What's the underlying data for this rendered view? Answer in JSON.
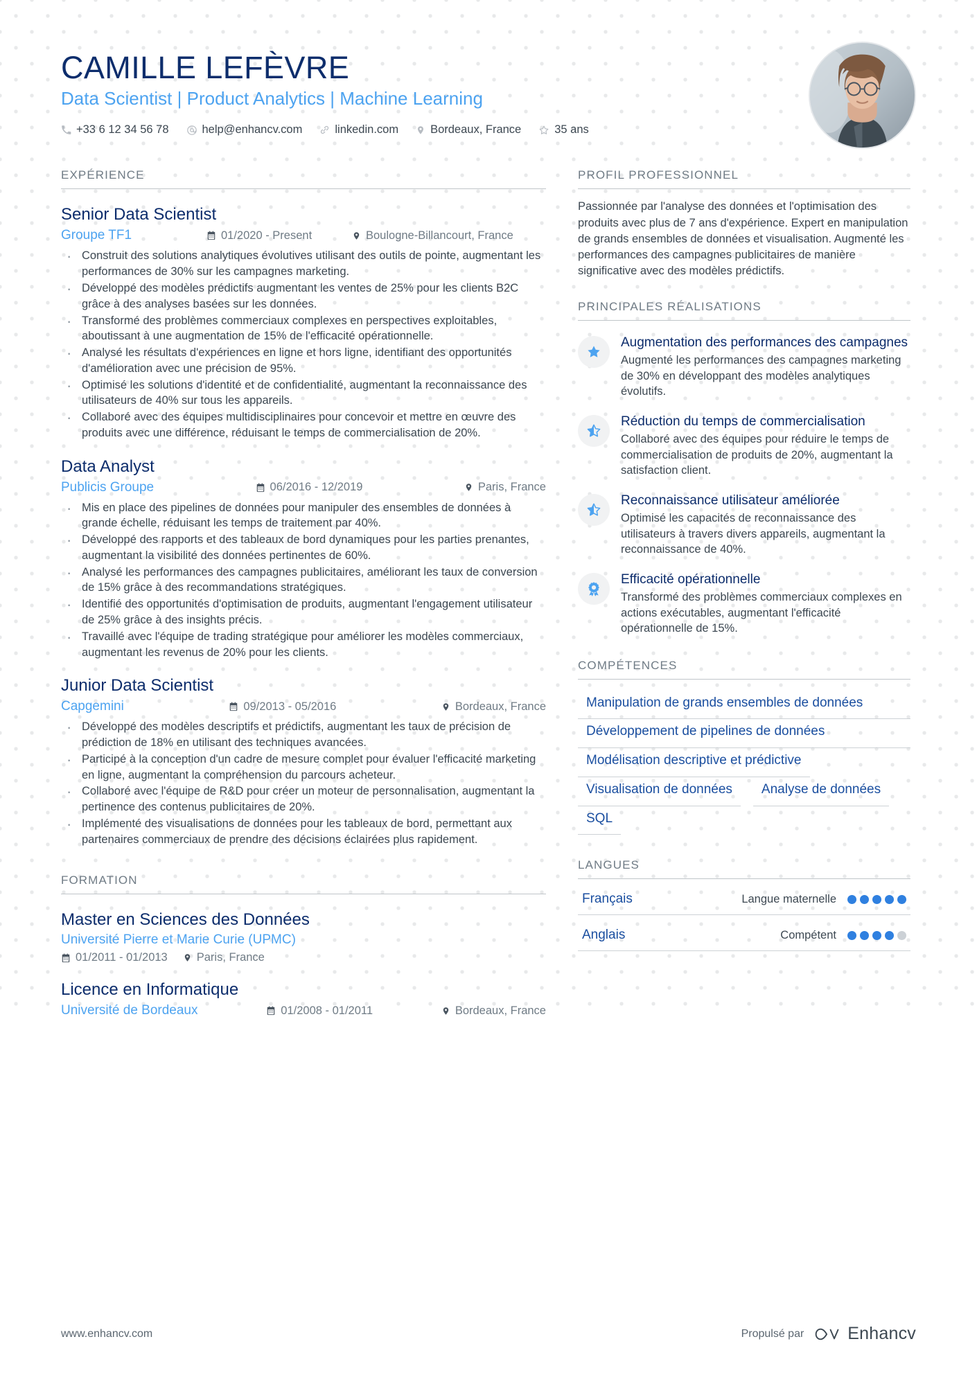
{
  "header": {
    "name": "CAMILLE LEFÈVRE",
    "headline": "Data Scientist | Product Analytics | Machine Learning",
    "contacts": [
      {
        "icon": "phone-icon",
        "text": "+33 6 12 34 56 78"
      },
      {
        "icon": "email-icon",
        "text": "help@enhancv.com"
      },
      {
        "icon": "link-icon",
        "text": "linkedin.com"
      },
      {
        "icon": "location-pin-icon",
        "text": "Bordeaux, France"
      },
      {
        "icon": "star-outline-icon",
        "text": "35 ans"
      }
    ],
    "avatar_alt": "profile-photo"
  },
  "experience": {
    "title": "EXPÉRIENCE",
    "entries": [
      {
        "role": "Senior Data Scientist",
        "company": "Groupe TF1",
        "dates": "01/2020 - Present",
        "location": "Boulogne-Billancourt, France",
        "bullets": [
          "Construit des solutions analytiques évolutives utilisant des outils de pointe, augmentant les performances de 30% sur les campagnes marketing.",
          "Développé des modèles prédictifs augmentant les ventes de 25% pour les clients B2C grâce à des analyses basées sur les données.",
          "Transformé des problèmes commerciaux complexes en perspectives exploitables, aboutissant à une augmentation de 15% de l'efficacité opérationnelle.",
          "Analysé les résultats d'expériences en ligne et hors ligne, identifiant des opportunités d'amélioration avec une précision de 95%.",
          "Optimisé les solutions d'identité et de confidentialité, augmentant la reconnaissance des utilisateurs de 40% sur tous les appareils.",
          "Collaboré avec des équipes multidisciplinaires pour concevoir et mettre en œuvre des produits avec une différence, réduisant le temps de commercialisation de 20%."
        ]
      },
      {
        "role": "Data Analyst",
        "company": "Publicis Groupe",
        "dates": "06/2016 - 12/2019",
        "location": "Paris, France",
        "bullets": [
          "Mis en place des pipelines de données pour manipuler des ensembles de données à grande échelle, réduisant les temps de traitement par 40%.",
          "Développé des rapports et des tableaux de bord dynamiques pour les parties prenantes, augmentant la visibilité des données pertinentes de 60%.",
          "Analysé les performances des campagnes publicitaires, améliorant les taux de conversion de 15% grâce à des recommandations stratégiques.",
          "Identifié des opportunités d'optimisation de produits, augmentant l'engagement utilisateur de 25% grâce à des insights précis.",
          "Travaillé avec l'équipe de trading stratégique pour améliorer les modèles commerciaux, augmentant les revenus de 20% pour les clients."
        ]
      },
      {
        "role": "Junior Data Scientist",
        "company": "Capgemini",
        "dates": "09/2013 - 05/2016",
        "location": "Bordeaux, France",
        "bullets": [
          "Développé des modèles descriptifs et prédictifs, augmentant les taux de précision de prédiction de 18% en utilisant des techniques avancées.",
          "Participé à la conception d'un cadre de mesure complet pour évaluer l'efficacité marketing en ligne, augmentant la compréhension du parcours acheteur.",
          "Collaboré avec l'équipe de R&D pour créer un moteur de personnalisation, augmentant la pertinence des contenus publicitaires de 20%.",
          "Implémenté des visualisations de données pour les tableaux de bord, permettant aux partenaires commerciaux de prendre des décisions éclairées plus rapidement."
        ]
      }
    ]
  },
  "education": {
    "title": "FORMATION",
    "entries": [
      {
        "degree": "Master en Sciences des Données",
        "school": "Université Pierre et Marie Curie (UPMC)",
        "dates": "01/2011 - 01/2013",
        "location": "Paris, France",
        "stacked": true
      },
      {
        "degree": "Licence en Informatique",
        "school": "Université de Bordeaux",
        "dates": "01/2008 - 01/2011",
        "location": "Bordeaux, France",
        "stacked": false
      }
    ]
  },
  "profile": {
    "title": "PROFIL PROFESSIONNEL",
    "text": "Passionnée par l'analyse des données et l'optimisation des produits avec plus de 7 ans d'expérience. Expert en manipulation de grands ensembles de données et visualisation. Augmenté les performances des campagnes publicitaires de manière significative avec des modèles prédictifs."
  },
  "achievements": {
    "title": "PRINCIPALES RÉALISATIONS",
    "items": [
      {
        "icon": "star-filled-icon",
        "title": "Augmentation des performances des campagnes",
        "desc": "Augmenté les performances des campagnes marketing de 30% en développant des modèles analytiques évolutifs."
      },
      {
        "icon": "star-half-icon",
        "title": "Réduction du temps de commercialisation",
        "desc": "Collaboré avec des équipes pour réduire le temps de commercialisation de produits de 20%, augmentant la satisfaction client."
      },
      {
        "icon": "star-half-icon",
        "title": "Reconnaissance utilisateur améliorée",
        "desc": "Optimisé les capacités de reconnaissance des utilisateurs à travers divers appareils, augmentant la reconnaissance de 40%."
      },
      {
        "icon": "award-badge-icon",
        "title": "Efficacité opérationnelle",
        "desc": "Transformé des problèmes commerciaux complexes en actions exécutables, augmentant l'efficacité opérationnelle de 15%."
      }
    ]
  },
  "skills": {
    "title": "COMPÉTENCES",
    "items": [
      {
        "label": "Manipulation de grands ensembles de données",
        "full": true
      },
      {
        "label": "Développement de pipelines de données",
        "full": true
      },
      {
        "label": "Modélisation descriptive et prédictive",
        "full": false
      },
      {
        "label": "Visualisation de données",
        "full": false
      },
      {
        "label": "Analyse de données",
        "full": false
      },
      {
        "label": "SQL",
        "full": false
      }
    ]
  },
  "languages": {
    "title": "LANGUES",
    "items": [
      {
        "name": "Français",
        "level": "Langue maternelle",
        "filled": 5,
        "total": 5
      },
      {
        "name": "Anglais",
        "level": "Compétent",
        "filled": 4,
        "total": 5
      }
    ]
  },
  "footer": {
    "url": "www.enhancv.com",
    "powered_by": "Propulsé par",
    "brand": "Enhancv"
  },
  "colors": {
    "navy": "#0d2d6c",
    "accent_blue": "#4da3f0",
    "link_blue": "#1b4fa0",
    "body_text": "#3d4852",
    "muted": "#6f7b85"
  }
}
